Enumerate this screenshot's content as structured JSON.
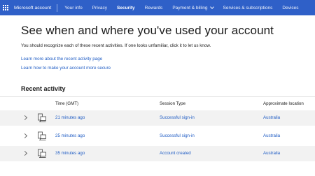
{
  "nav": {
    "brand": "Microsoft account",
    "items": [
      {
        "label": "Your info",
        "active": false
      },
      {
        "label": "Privacy",
        "active": false
      },
      {
        "label": "Security",
        "active": true
      },
      {
        "label": "Rewards",
        "active": false
      },
      {
        "label": "Payment & billing",
        "active": false,
        "has_dropdown": true
      },
      {
        "label": "Services & subscriptions",
        "active": false
      },
      {
        "label": "Devices",
        "active": false
      }
    ],
    "background_color": "#2f60c8"
  },
  "page": {
    "title": "See when and where you've used your account",
    "intro": "You should recognize each of these recent activities. If one looks unfamiliar, click it to let us know.",
    "links": [
      "Learn more about the recent activity page",
      "Learn how to make your account more secure"
    ]
  },
  "recent_activity": {
    "heading": "Recent activity",
    "columns": [
      "Time (GMT)",
      "Session Type",
      "Approximate location"
    ],
    "rows": [
      {
        "time": "21 minutes ago",
        "session_type": "Successful sign-in",
        "location": "Australia",
        "icon": "computer-device-icon"
      },
      {
        "time": "25 minutes ago",
        "session_type": "Successful sign-in",
        "location": "Australia",
        "icon": "computer-device-icon"
      },
      {
        "time": "35 minutes ago",
        "session_type": "Account created",
        "location": "Australia",
        "icon": "computer-device-icon"
      }
    ]
  },
  "colors": {
    "link": "#1f5cc4",
    "row_highlight": "#f2f2f2"
  }
}
